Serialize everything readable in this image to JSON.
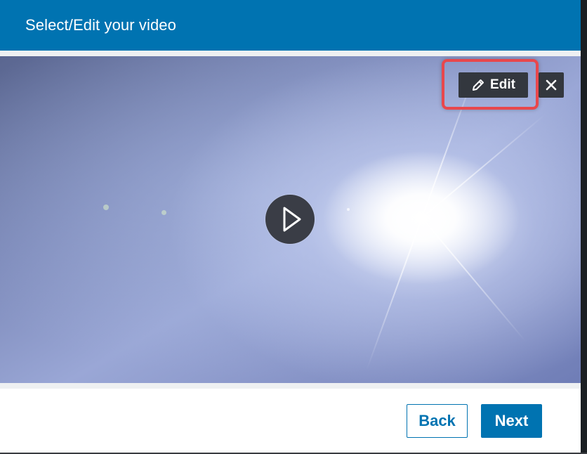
{
  "dialog": {
    "title": "Select/Edit your video"
  },
  "video": {
    "edit_label": "Edit",
    "play_icon": "play-icon",
    "edit_icon": "pencil-icon",
    "close_icon": "close-icon"
  },
  "footer": {
    "back_label": "Back",
    "next_label": "Next"
  },
  "colors": {
    "header": "#0073b1",
    "primary": "#0073b1",
    "overlay_button": "#33373e",
    "highlight": "#e8474c"
  }
}
